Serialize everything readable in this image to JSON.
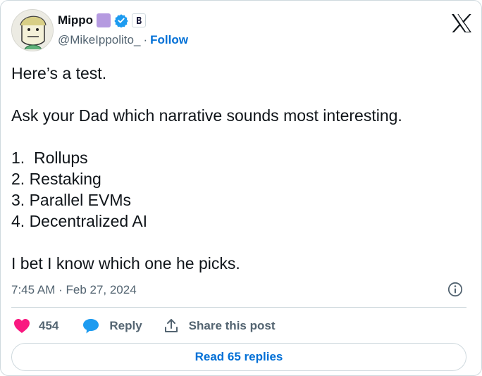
{
  "author": {
    "display_name": "Mippo",
    "handle": "@MikeIppolito_",
    "separator": "·",
    "follow_label": "Follow",
    "verified_color": "#1d9bf0",
    "emoji_color": "#b59ae0",
    "badge_letter": "B"
  },
  "tweet": {
    "lines": [
      "Here’s a test.",
      "",
      "Ask your Dad which narrative sounds most interesting.",
      "",
      "1.  Rollups",
      "2. Restaking",
      "3. Parallel EVMs",
      "4. Decentralized AI",
      "",
      "I bet I know which one he picks."
    ],
    "timestamp": "7:45 AM · Feb 27, 2024"
  },
  "actions": {
    "like_count": "454",
    "reply_label": "Reply",
    "share_label": "Share this post",
    "like_color": "#f91880",
    "reply_color": "#1d9bf0"
  },
  "footer": {
    "read_replies_label": "Read 65 replies"
  },
  "icons": {
    "brand": "x-logo-icon",
    "info": "info-icon",
    "like": "heart-icon",
    "reply": "speech-bubble-icon",
    "share": "share-upload-icon",
    "verified": "verified-badge-icon"
  }
}
